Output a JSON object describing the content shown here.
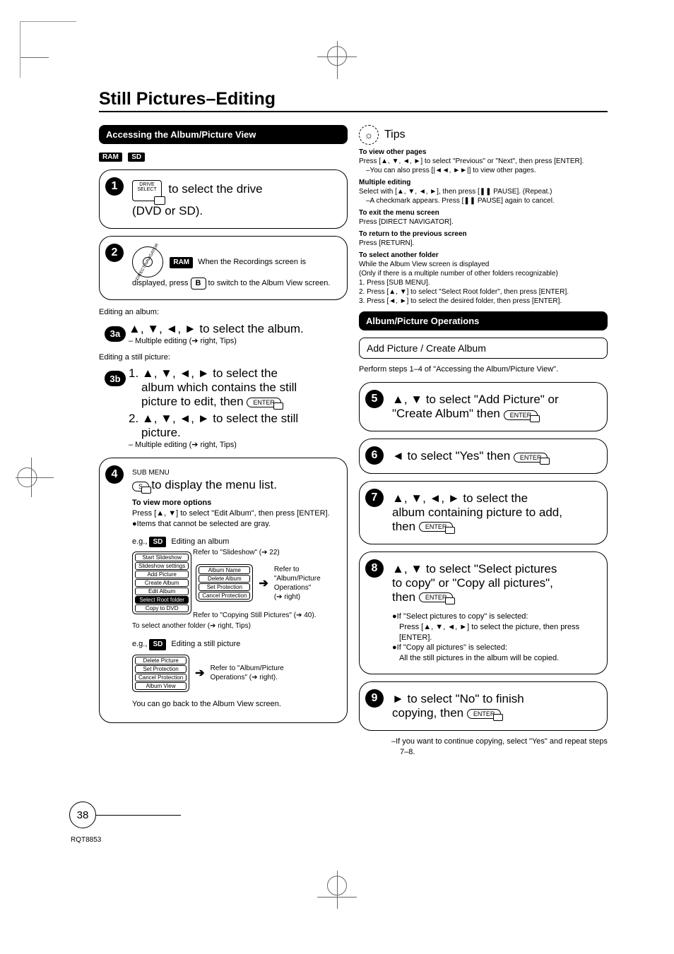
{
  "page": {
    "title": "Still Pictures–Editing",
    "number": "38",
    "model": "RQT8853"
  },
  "left": {
    "section_title": "Accessing the Album/Picture View",
    "badges": {
      "ram": "RAM",
      "sd": "SD"
    },
    "step1": {
      "remote_label": "DRIVE\nSELECT",
      "text_a": " to select the drive",
      "text_b": "(DVD or SD)."
    },
    "step2": {
      "ram": "RAM",
      "t1": " When the Recordings screen is displayed, press ",
      "key": "B",
      "t2": " to switch to the Album View screen."
    },
    "editing_album": "Editing an album:",
    "step3a": {
      "label": "3a",
      "main": "▲, ▼, ◄, ► to select the album.",
      "sub": "– Multiple editing (➔ right, Tips)"
    },
    "editing_still": "Editing a still picture:",
    "step3b": {
      "label": "3b",
      "l1a": "1. ▲, ▼, ◄, ► to select the",
      "l1b": "album which contains the still",
      "l1c": "picture to edit, then ",
      "enter1": "ENTER",
      "l2a": "2. ▲, ▼, ◄, ► to select the still",
      "l2b": "picture.",
      "sub": "– Multiple editing (➔ right, Tips)"
    },
    "step4": {
      "submenu": "SUB MENU",
      "s": "S",
      "main": " to display the menu list.",
      "opt_head": "To view more options",
      "opt_l1": "Press [▲, ▼] to select \"Edit Album\", then press [ENTER].",
      "opt_l2": "●Items that cannot be selected are gray.",
      "eg1_pre": "e.g., ",
      "eg1_sd": "SD",
      "eg1_post": " Editing an album",
      "menu_a": [
        "Start Slideshow",
        "Slideshow settings",
        "Add Picture",
        "Create Album",
        "Edit Album",
        "Select Root folder",
        "Copy to DVD"
      ],
      "menu_b": [
        "Album Name",
        "Delete Album",
        "Set Protection",
        "Cancel Protection"
      ],
      "note_slideshow": "Refer to \"Slideshow\" (➔ 22)",
      "note_ops_a": "Refer to",
      "note_ops_b": "\"Album/Picture",
      "note_ops_c": "Operations\"",
      "note_ops_d": "(➔ right)",
      "note_copy": "Refer to \"Copying Still Pictures\" (➔ 40).",
      "note_folder": "To select another folder (➔ right, Tips)",
      "eg2_pre": "e.g., ",
      "eg2_sd": "SD",
      "eg2_post": " Editing a still picture",
      "menu_c": [
        "Delete Picture",
        "Set Protection",
        "Cancel Protection",
        "Album View"
      ],
      "note_ops2a": "Refer to \"Album/Picture",
      "note_ops2b": "Operations\" (➔ right).",
      "back": "You can go back to the Album View screen."
    }
  },
  "tips": {
    "heading": "Tips",
    "h1": "To view other pages",
    "l1a": "Press [▲, ▼, ◄, ►] to select \"Previous\" or \"Next\", then press [ENTER].",
    "l1b": "–You can also press [|◄◄, ►►|] to view other pages.",
    "h2": "Multiple editing",
    "l2a": "Select with [▲, ▼, ◄, ►], then press [❚❚ PAUSE]. (Repeat.)",
    "l2b": "–A checkmark appears. Press [❚❚ PAUSE] again to cancel.",
    "h3": "To exit the menu screen",
    "l3": "Press [DIRECT NAVIGATOR].",
    "h4": "To return to the previous screen",
    "l4": "Press [RETURN].",
    "h5": "To select another folder",
    "l5a": "While the Album View screen is displayed",
    "l5b": "(Only if there is a multiple number of other folders recognizable)",
    "l5c": "1. Press [SUB MENU].",
    "l5d": "2. Press [▲, ▼] to select \"Select Root folder\", then press [ENTER].",
    "l5e": "3. Press [◄, ►] to select the desired folder, then press [ENTER]."
  },
  "right": {
    "section_title": "Album/Picture Operations",
    "sub_title": "Add Picture / Create Album",
    "intro": "Perform steps 1–4 of \"Accessing the Album/Picture View\".",
    "s5": {
      "t": "▲, ▼ to select \"Add Picture\" or \"Create Album\" then ",
      "enter": "ENTER"
    },
    "s6": {
      "t": "◄ to select \"Yes\" then ",
      "enter": "ENTER"
    },
    "s7": {
      "t1": "▲, ▼, ◄, ► to select the",
      "t2": "album containing picture to add,",
      "t3": "then ",
      "enter": "ENTER"
    },
    "s8": {
      "t1": "▲, ▼ to select \"Select pictures",
      "t2": "to copy\" or \"Copy all pictures\",",
      "t3": "then ",
      "enter": "ENTER",
      "b1a": "●If \"Select pictures to copy\" is selected:",
      "b1b": "Press [▲, ▼, ◄, ►] to select the picture, then press [ENTER].",
      "b2a": "●If \"Copy all pictures\" is selected:",
      "b2b": "All the still pictures in the album will be copied."
    },
    "s9": {
      "t1": "► to select \"No\" to finish",
      "t2": "copying, then ",
      "enter": "ENTER",
      "n1": "–If you want to continue copying, select \"Yes\" and repeat steps 7–8."
    }
  }
}
